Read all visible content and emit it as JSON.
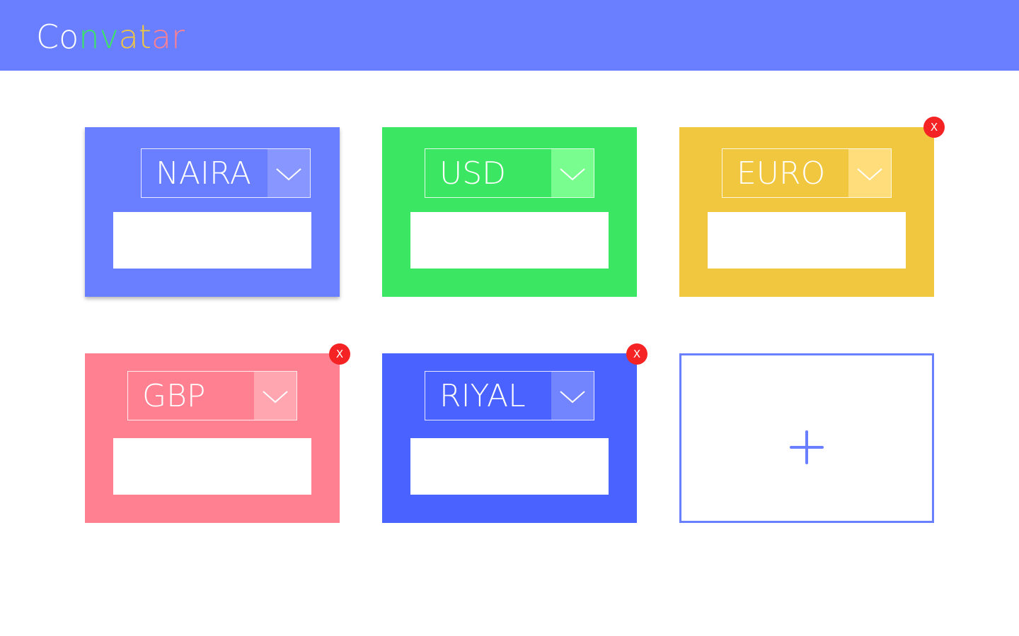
{
  "app": {
    "logo_letters": [
      {
        "char": "C",
        "color": "#ffffff"
      },
      {
        "char": "o",
        "color": "#ffffff"
      },
      {
        "char": "n",
        "color": "#3be662"
      },
      {
        "char": "v",
        "color": "#3be662"
      },
      {
        "char": "a",
        "color": "#f2c740"
      },
      {
        "char": "t",
        "color": "#f2c740"
      },
      {
        "char": "a",
        "color": "#ff8090"
      },
      {
        "char": "r",
        "color": "#ff8090"
      }
    ],
    "header_color": "#6a7fff"
  },
  "cards": [
    {
      "currency": "NAIRA",
      "amount": "",
      "color": "#6a7fff",
      "arrow_bg": "#8797ff",
      "removable": false,
      "remove_label": ""
    },
    {
      "currency": "USD",
      "amount": "",
      "color": "#3be662",
      "arrow_bg": "#79fd8e",
      "removable": false,
      "remove_label": ""
    },
    {
      "currency": "EURO",
      "amount": "",
      "color": "#f2c740",
      "arrow_bg": "#ffdd7a",
      "removable": true,
      "remove_label": "X"
    },
    {
      "currency": "GBP",
      "amount": "",
      "color": "#ff8090",
      "arrow_bg": "#ffa6b0",
      "removable": true,
      "remove_label": "X"
    },
    {
      "currency": "RIYAL",
      "amount": "",
      "color": "#4a62ff",
      "arrow_bg": "#7285ff",
      "removable": true,
      "remove_label": "X"
    }
  ],
  "add_card": {
    "icon": "plus-icon",
    "color": "#6a7fff"
  },
  "icons": {
    "dropdown": "chevron-down-icon",
    "remove": "close-icon"
  }
}
